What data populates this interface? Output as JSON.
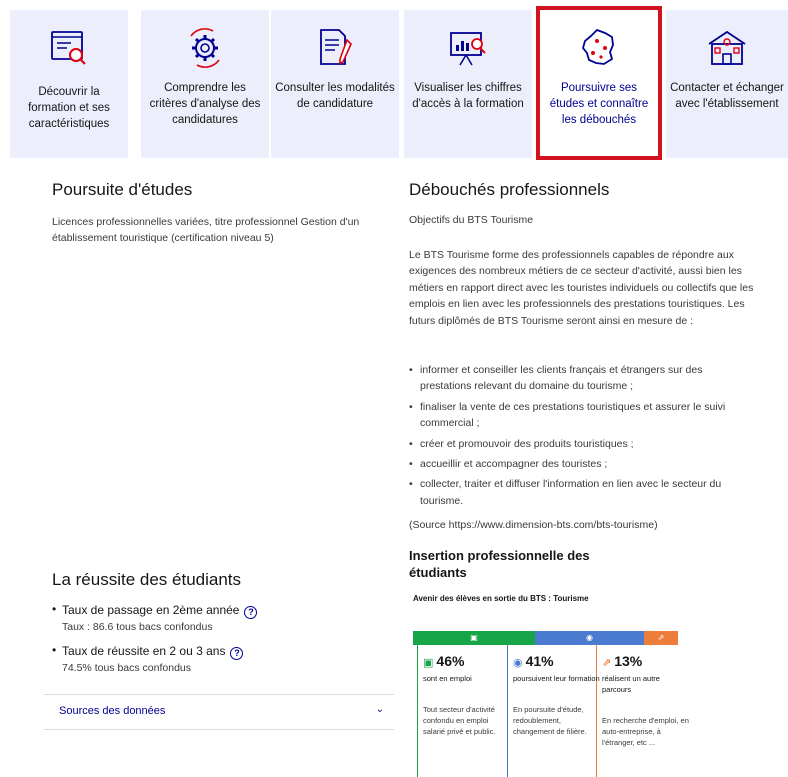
{
  "tabs": [
    {
      "label": "Découvrir la formation et ses caractéristiques",
      "icon": "magnifier-document-icon",
      "active": false
    },
    {
      "label": "Comprendre les critères d'analyse des candidatures",
      "icon": "gear-cycle-icon",
      "active": false
    },
    {
      "label": "Consulter les modalités de candidature",
      "icon": "document-pen-icon",
      "active": false
    },
    {
      "label": "Visualiser les chiffres d'accès à la formation",
      "icon": "presentation-chart-icon",
      "active": false
    },
    {
      "label": "Poursuivre ses études et connaître les débouchés",
      "icon": "france-map-icon",
      "active": true
    },
    {
      "label": "Contacter et échanger avec l'établissement",
      "icon": "school-building-icon",
      "active": false
    }
  ],
  "left": {
    "title": "Poursuite d'études",
    "text": "Licences professionnelles variées, titre professionnel Gestion d'un établissement touristique (certification niveau 5)",
    "success_title": "La réussite des étudiants",
    "stats": [
      {
        "name": "Taux de passage en 2ème année",
        "value": "Taux : 86.6 tous bacs confondus"
      },
      {
        "name": "Taux de réussite en 2 ou 3 ans",
        "value": "74.5% tous bacs confondus"
      }
    ],
    "sources_label": "Sources des données"
  },
  "right": {
    "title": "Débouchés professionnels",
    "objectives": "Objectifs du BTS Tourisme",
    "intro": "Le BTS Tourisme forme des professionnels capables de répondre aux exigences des nombreux métiers de ce secteur d'activité, aussi bien les métiers en rapport direct avec les touristes individuels ou collectifs que les emplois en lien avec les professionnels des prestations touristiques. Les futurs diplômés de BTS Tourisme seront ainsi en mesure de :",
    "bullets": [
      "informer et conseiller les clients français et étrangers sur des prestations relevant du domaine du tourisme ;",
      "finaliser la vente de ces prestations touristiques et assurer le suivi commercial ;",
      "créer et promouvoir des produits touristiques ;",
      "accueillir et accompagner des touristes ;",
      "collecter, traiter et diffuser l'information en lien avec le secteur du tourisme."
    ],
    "source": "(Source https://www.dimension-bts.com/bts-tourisme)",
    "insertion_title": "Insertion professionnelle des étudiants",
    "chart_caption": "Avenir des élèves en sortie du BTS : Tourisme"
  },
  "insertion": [
    {
      "pct": "46%",
      "share": 46,
      "label": "sont en emploi",
      "desc": "Tout secteur d'activité confondu en emploi salarié privé et public.",
      "color": "#18a547",
      "icon": "briefcase-icon",
      "bar_icon": "▣",
      "cicon": "▣"
    },
    {
      "pct": "41%",
      "share": 41,
      "label": "poursuivent leur formation",
      "desc": "En poursuite d'étude, redoublement, changement de filière.",
      "color": "#4b7bd1",
      "icon": "graduation-cap-icon",
      "bar_icon": "◉",
      "cicon": "◉"
    },
    {
      "pct": "13%",
      "share": 13,
      "label": "réalisent un autre parcours",
      "desc": "En recherche d'emploi, en auto-entreprise, à l'étranger, etc ...",
      "color": "#ed7d3a",
      "icon": "path-icon",
      "bar_icon": "⇗",
      "cicon": "⇗"
    }
  ]
}
